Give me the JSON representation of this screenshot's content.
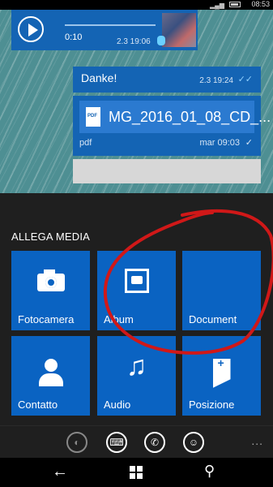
{
  "status_bar": {
    "time": "08:53"
  },
  "chat": {
    "audio_message": {
      "duration": "0:10",
      "time": "2.3 19:06"
    },
    "text_message": {
      "text": "Danke!",
      "time": "2.3 19:24",
      "status_icon": "double-check-icon"
    },
    "file_message": {
      "filename": "MG_2016_01_08_CD_...",
      "type": "pdf",
      "icon_label": "PDF",
      "time": "mar 09:03",
      "status_icon": "check-icon"
    }
  },
  "attach_panel": {
    "heading": "ALLEGA MEDIA",
    "tiles": [
      {
        "label": "Fotocamera",
        "icon": "camera-icon"
      },
      {
        "label": "Album",
        "icon": "album-icon"
      },
      {
        "label": "Document",
        "icon": "document-icon"
      },
      {
        "label": "Contatto",
        "icon": "contact-icon"
      },
      {
        "label": "Audio",
        "icon": "music-note-icon"
      },
      {
        "label": "Posizione",
        "icon": "location-icon"
      }
    ],
    "tile_color": "#0a63c2"
  },
  "app_bar": {
    "buttons": [
      "voice-icon",
      "keyboard-icon",
      "phone-icon",
      "emoji-icon"
    ],
    "more": "..."
  },
  "annotation": {
    "color": "#d01818",
    "shape": "hand-drawn circle around Album and Document tiles"
  }
}
